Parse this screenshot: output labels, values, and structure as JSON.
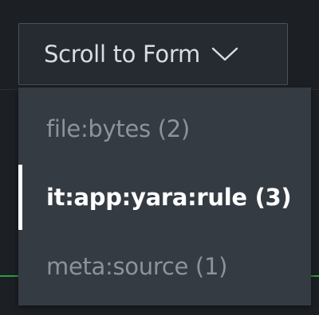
{
  "scroll_button": {
    "label": "Scroll to Form",
    "icon": "chevron-down-icon"
  },
  "menu": {
    "items": [
      {
        "label": "file:bytes (2)",
        "state": "normal"
      },
      {
        "label": "it:app:yara:rule (3)",
        "state": "selected"
      },
      {
        "label": "meta:source (1)",
        "state": "normal"
      }
    ]
  },
  "colors": {
    "background": "#1c2025",
    "menu_background": "#353b43",
    "button_background": "#262b32",
    "muted_text": "#8c939b",
    "active_text": "#ffffff",
    "accent_green": "#2e9f3a"
  }
}
